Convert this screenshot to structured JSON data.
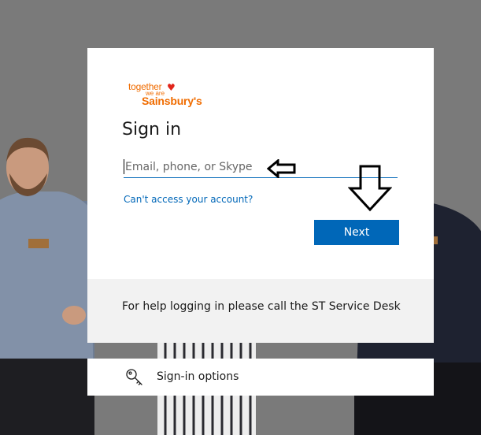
{
  "brand": {
    "tagline_top": "together",
    "tagline_mid": "we are",
    "name": "Sainsbury's",
    "color": "#f06c00",
    "heart_color": "#e1251b"
  },
  "signin": {
    "title": "Sign in",
    "email_placeholder": "Email, phone, or Skype",
    "email_value": "",
    "cant_access_link": "Can't access your account?",
    "next_button": "Next"
  },
  "help": {
    "text": "For help logging in please call the ST Service Desk"
  },
  "options": {
    "label": "Sign-in options",
    "icon": "key-icon"
  },
  "colors": {
    "accent": "#0067b8",
    "background": "#7a7a7a",
    "help_bg": "#f2f2f2"
  }
}
